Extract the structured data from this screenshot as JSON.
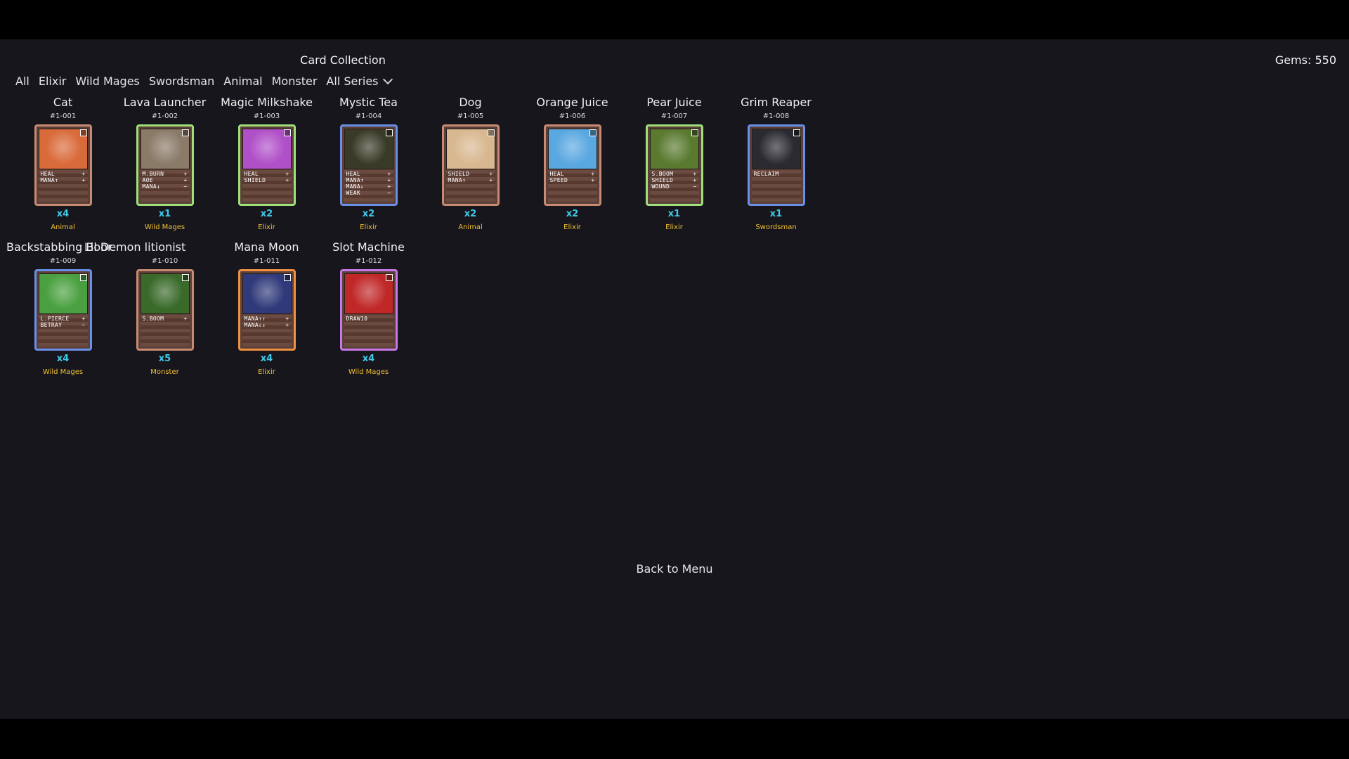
{
  "title": "Card Collection",
  "gems": "Gems: 550",
  "filters": [
    "All",
    "Elixir",
    "Wild Mages",
    "Swordsman",
    "Animal",
    "Monster"
  ],
  "series_select": "All Series",
  "back_label": "Back to Menu",
  "colors": {
    "count": "#3ec9e8",
    "series": "#f0c030",
    "background": "#17161d"
  },
  "cards": [
    {
      "name": "Cat",
      "number": "#1-001",
      "count": "x4",
      "series": "Animal",
      "frame_color": "#c88a70",
      "art_color": "#d96a3a",
      "stats": [
        [
          "HEAL",
          "+"
        ],
        [
          "MANA↑",
          "+"
        ]
      ]
    },
    {
      "name": "Lava Launcher",
      "number": "#1-002",
      "count": "x1",
      "series": "Wild Mages",
      "frame_color": "#9fe07a",
      "art_color": "#8a7a68",
      "stats": [
        [
          "M.BURN",
          "+"
        ],
        [
          "AOE",
          "+"
        ],
        [
          "MANA↓",
          "−"
        ]
      ]
    },
    {
      "name": "Magic Milkshake",
      "number": "#1-003",
      "count": "x2",
      "series": "Elixir",
      "frame_color": "#9fe07a",
      "art_color": "#b050c8",
      "stats": [
        [
          "HEAL",
          "+"
        ],
        [
          "SHIELD",
          "+"
        ]
      ]
    },
    {
      "name": "Mystic Tea",
      "number": "#1-004",
      "count": "x2",
      "series": "Elixir",
      "frame_color": "#6a8fe8",
      "art_color": "#3a3a28",
      "stats": [
        [
          "HEAL",
          "+"
        ],
        [
          "MANA↑",
          "+"
        ],
        [
          "MANA⇓",
          "+"
        ],
        [
          "WEAK",
          "−"
        ]
      ]
    },
    {
      "name": "Dog",
      "number": "#1-005",
      "count": "x2",
      "series": "Animal",
      "frame_color": "#c88a70",
      "art_color": "#d8b890",
      "stats": [
        [
          "SHIELD",
          "+"
        ],
        [
          "MANA↑",
          "+"
        ]
      ]
    },
    {
      "name": "Orange Juice",
      "number": "#1-006",
      "count": "x2",
      "series": "Elixir",
      "frame_color": "#c88a70",
      "art_color": "#5aa8e0",
      "stats": [
        [
          "HEAL",
          "+"
        ],
        [
          "SPEED",
          "+"
        ]
      ]
    },
    {
      "name": "Pear Juice",
      "number": "#1-007",
      "count": "x1",
      "series": "Elixir",
      "frame_color": "#9fe07a",
      "art_color": "#5a7a30",
      "stats": [
        [
          "S.BOOM",
          "+"
        ],
        [
          "SHIELD",
          "+"
        ],
        [
          "WOUND",
          "−"
        ]
      ]
    },
    {
      "name": "Grim Reaper",
      "number": "#1-008",
      "count": "x1",
      "series": "Swordsman",
      "frame_color": "#6a8fe8",
      "art_color": "#2a2a30",
      "stats": [
        [
          "RECLAIM",
          ""
        ]
      ]
    },
    {
      "name": "Backstabbing Boor",
      "number": "#1-009",
      "count": "x4",
      "series": "Wild Mages",
      "frame_color": "#6a8fe8",
      "art_color": "#4aa040",
      "stats": [
        [
          "L.PIERCE",
          "+"
        ],
        [
          "BETRAY",
          "−"
        ]
      ]
    },
    {
      "name": "Lil Demon",
      "name_extra": "litionist",
      "number": "#1-010",
      "count": "x5",
      "series": "Monster",
      "frame_color": "#c88a70",
      "art_color": "#3a6a2a",
      "stats": [
        [
          "S.BOOM",
          "+"
        ]
      ]
    },
    {
      "name": "Mana Moon",
      "number": "#1-011",
      "count": "x4",
      "series": "Elixir",
      "frame_color": "#f09040",
      "art_color": "#303a7a",
      "stats": [
        [
          "MANA↑↑",
          "+"
        ],
        [
          "MANA⇓⇓",
          "+"
        ]
      ]
    },
    {
      "name": "Slot Machine",
      "number": "#1-012",
      "count": "x4",
      "series": "Wild Mages",
      "frame_color": "#c878e8",
      "art_color": "#c02828",
      "stats": [
        [
          "DRAW10",
          ""
        ]
      ]
    }
  ]
}
